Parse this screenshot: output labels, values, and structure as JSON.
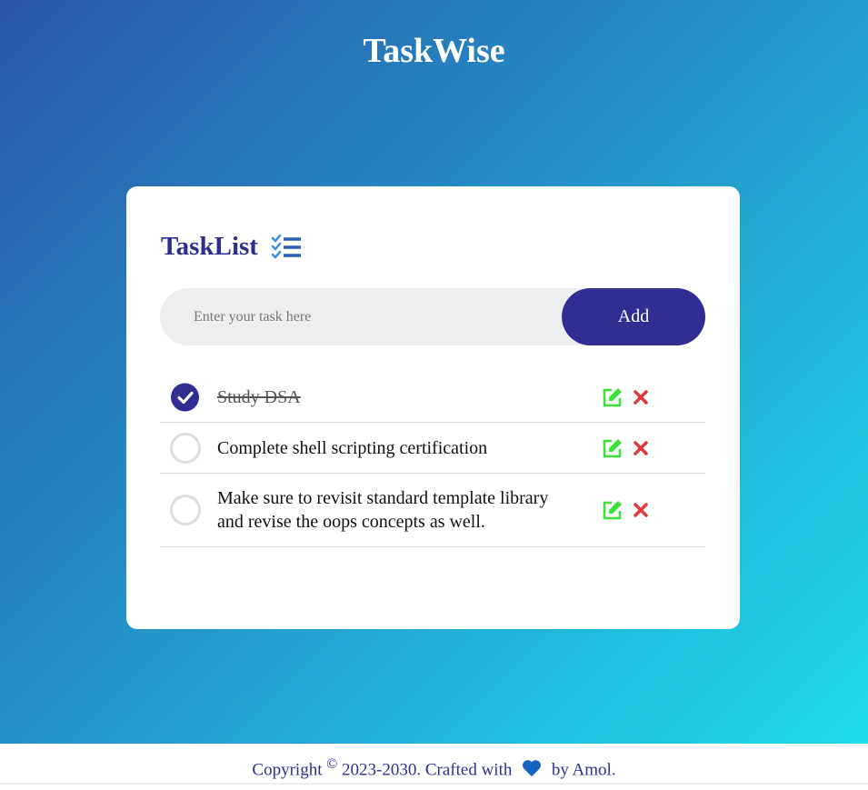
{
  "app": {
    "title": "TaskWise"
  },
  "card": {
    "heading": "TaskList",
    "heading_icon": "checklist-icon"
  },
  "input": {
    "placeholder": "Enter your task here",
    "value": "",
    "add_label": "Add"
  },
  "tasks": [
    {
      "text": "Study DSA",
      "done": true
    },
    {
      "text": "Complete shell scripting certification",
      "done": false
    },
    {
      "text": "Make sure to revisit standard template library and revise the oops concepts as well.",
      "done": false
    }
  ],
  "footer": {
    "prefix": "Copyright",
    "copy_symbol": "©",
    "middle": "2023-2030. Crafted with",
    "suffix": "by Amol.",
    "heart_icon": "blue-heart-icon"
  },
  "colors": {
    "accent": "#302e92",
    "edit": "#3ee03a",
    "delete": "#e0393c",
    "heart": "#1565c0"
  }
}
